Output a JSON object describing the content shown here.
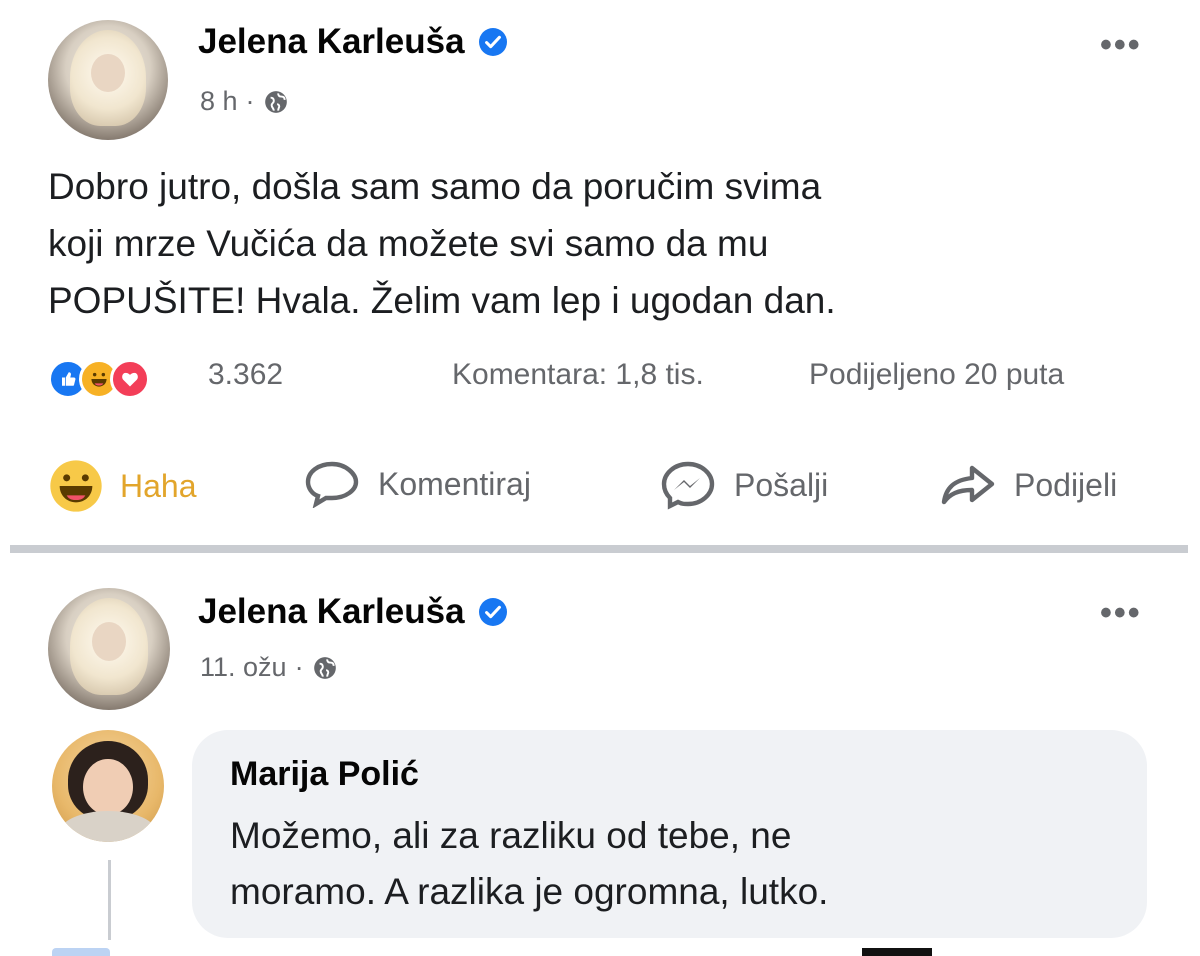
{
  "post1": {
    "author": "Jelena Karleuša",
    "time": "8 h",
    "dot": "·",
    "text_lines": [
      "Dobro jutro, došla sam samo da poručim svima",
      "koji mrze Vučića da možete svi samo da mu",
      "POPUŠITE! Hvala. Želim vam lep i ugodan dan."
    ],
    "reactions": {
      "icons": [
        "like-icon",
        "haha-icon",
        "love-icon"
      ],
      "count": "3.362",
      "comments": "Komentara: 1,8 tis.",
      "shares": "Podijeljeno 20 puta"
    },
    "actions": {
      "reaction_label": "Haha",
      "comment_label": "Komentiraj",
      "send_label": "Pošalji",
      "share_label": "Podijeli"
    }
  },
  "post2": {
    "author": "Jelena Karleuša",
    "time": "11. ožu",
    "dot": "·",
    "comment": {
      "author": "Marija Polić",
      "text_lines": [
        "Možemo, ali za razliku od tebe, ne",
        "moramo. A razlika je ogromna, lutko."
      ]
    }
  },
  "more_menu": "•••",
  "colors": {
    "verified": "#1877f2",
    "haha_active": "#e2a52b",
    "secondary_text": "#65676b",
    "comment_bubble": "#f0f2f5"
  }
}
